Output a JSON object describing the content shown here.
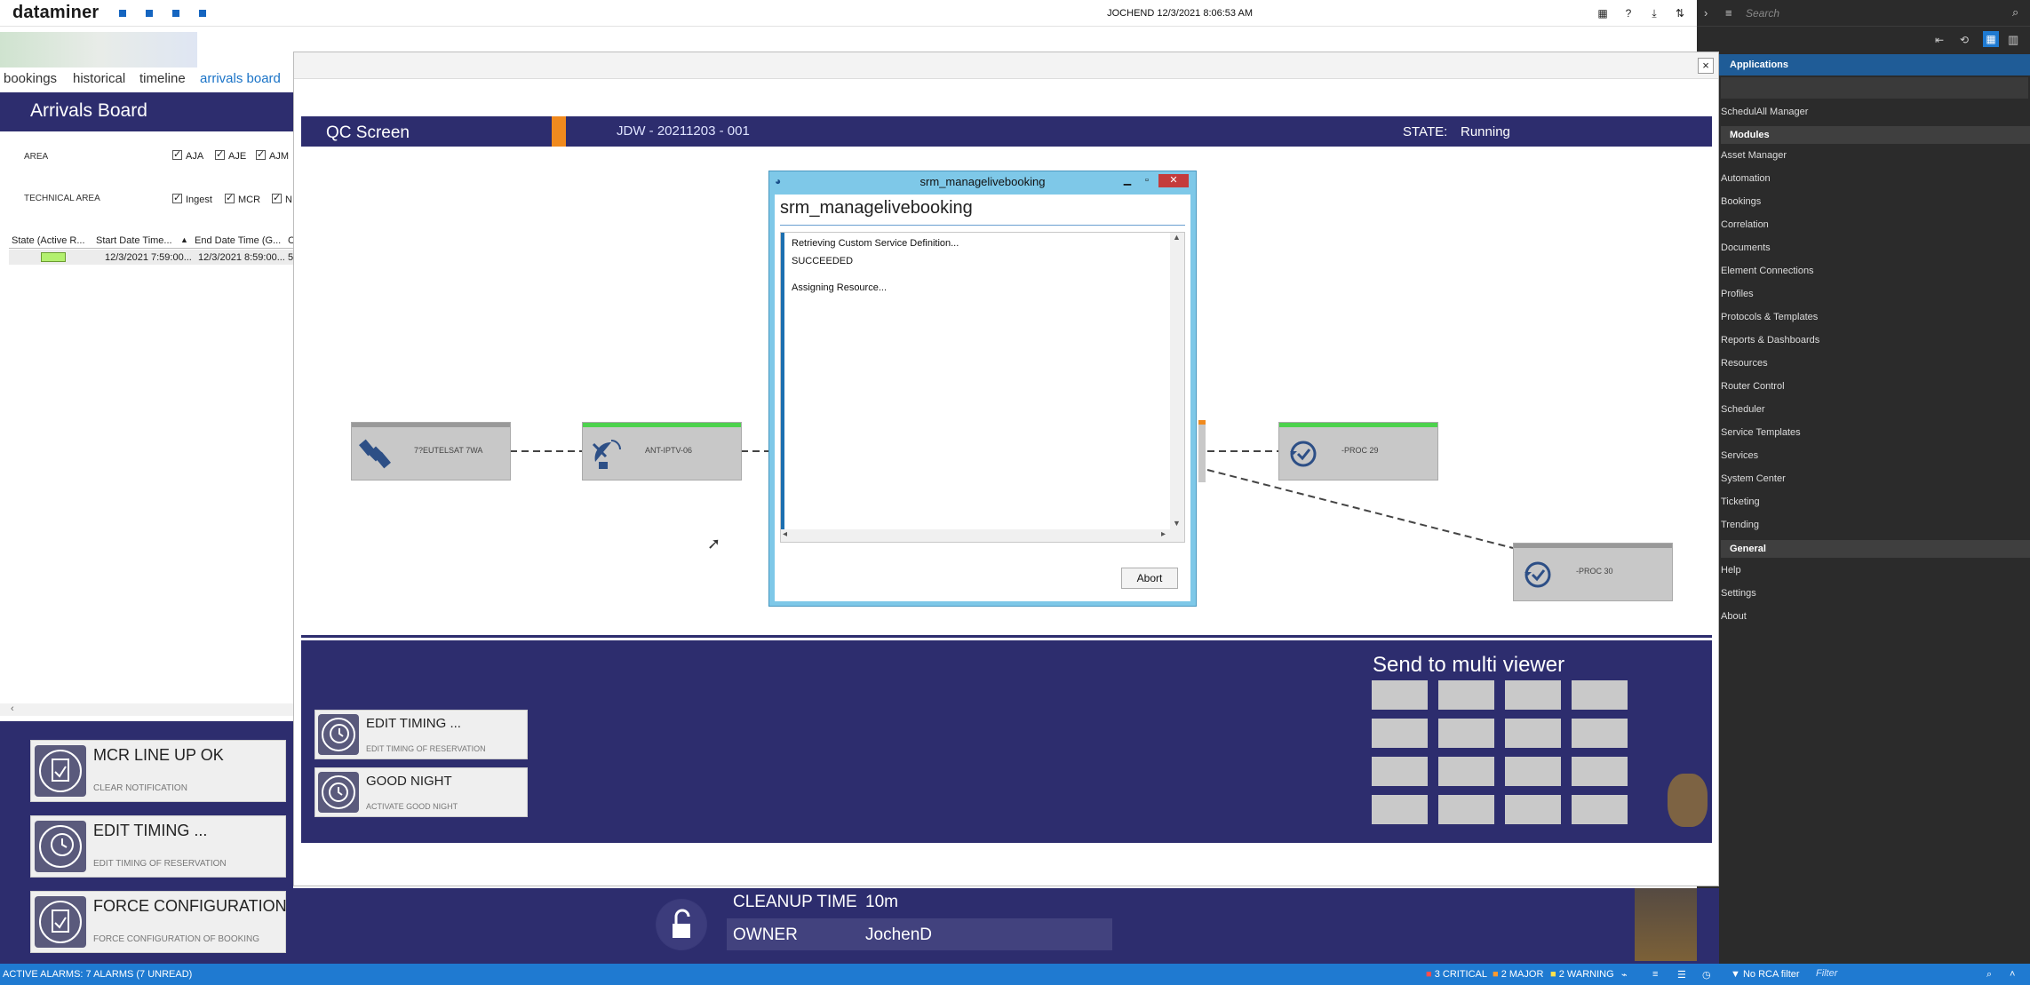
{
  "topbar": {
    "logo": "dataminer",
    "user_time": "JOCHEND 12/3/2021 8:06:53 AM"
  },
  "left_panel": {
    "tabs": [
      {
        "label": "bookings"
      },
      {
        "label": "historical"
      },
      {
        "label": "timeline"
      },
      {
        "label": "arrivals board"
      }
    ],
    "active_tab": "arrivals board",
    "header": "Arrivals Board",
    "area_label": "AREA",
    "area_options": [
      "AJA",
      "AJE",
      "AJM"
    ],
    "technical_area_label": "TECHNICAL AREA",
    "technical_area_options": [
      "Ingest",
      "MCR",
      "N"
    ],
    "grid": {
      "columns": [
        "State (Active R...",
        "Start Date Time...",
        "End Date Time (G...",
        "C"
      ],
      "rows": [
        {
          "start": "12/3/2021 7:59:00...",
          "end": "12/3/2021 8:59:00...",
          "extra": "5"
        }
      ]
    },
    "actions": [
      {
        "title": "MCR LINE UP OK",
        "subtitle": "CLEAR NOTIFICATION"
      },
      {
        "title": "EDIT TIMING ...",
        "subtitle": "EDIT TIMING OF RESERVATION"
      },
      {
        "title": "FORCE CONFIGURATION",
        "subtitle": "FORCE CONFIGURATION OF BOOKING"
      }
    ]
  },
  "main": {
    "qc_title": "QC Screen",
    "job": "JDW - 20211203 - 001",
    "state_label": "STATE:",
    "state_value": "Running",
    "nodes": [
      {
        "label": "7?EUTELSAT 7WA"
      },
      {
        "label": "ANT-IPTV-06"
      },
      {
        "label": "-PROC 29"
      },
      {
        "label": "-PROC 30"
      }
    ],
    "actions": [
      {
        "title": "EDIT TIMING ...",
        "subtitle": "EDIT TIMING OF RESERVATION"
      },
      {
        "title": "GOOD NIGHT",
        "subtitle": "ACTIVATE GOOD NIGHT"
      }
    ],
    "send_label": "Send to multi viewer",
    "cleanup_label": "CLEANUP TIME",
    "cleanup_value": "10m",
    "owner_label": "OWNER",
    "owner_value": "JochenD"
  },
  "dialog": {
    "window_title": "srm_managelivebooking",
    "heading": "srm_managelivebooking",
    "log": [
      "Retrieving Custom Service Definition...",
      "SUCCEEDED",
      "Assigning Resource..."
    ],
    "abort_label": "Abort"
  },
  "right_panel": {
    "search_placeholder": "Search",
    "applications_label": "Applications",
    "top_item": "SchedulAll Manager",
    "modules_label": "Modules",
    "modules": [
      "Asset Manager",
      "Automation",
      "Bookings",
      "Correlation",
      "Documents",
      "Element Connections",
      "Profiles",
      "Protocols & Templates",
      "Reports & Dashboards",
      "Resources",
      "Router Control",
      "Scheduler",
      "Service Templates",
      "Services",
      "System Center",
      "Ticketing",
      "Trending"
    ],
    "general_label": "General",
    "general": [
      "Help",
      "Settings",
      "About"
    ]
  },
  "status_bar": {
    "alarms": "ACTIVE ALARMS: 7 ALARMS (7 UNREAD)",
    "critical": "3 CRITICAL",
    "major": "2 MAJOR",
    "warning": "2 WARNING",
    "rca": "No RCA filter",
    "filter_placeholder": "Filter"
  },
  "colors": {
    "navy": "#2d2d6e",
    "accent_blue": "#1f7ad1",
    "status_green": "#4dd24d",
    "orange": "#f08a1e"
  }
}
